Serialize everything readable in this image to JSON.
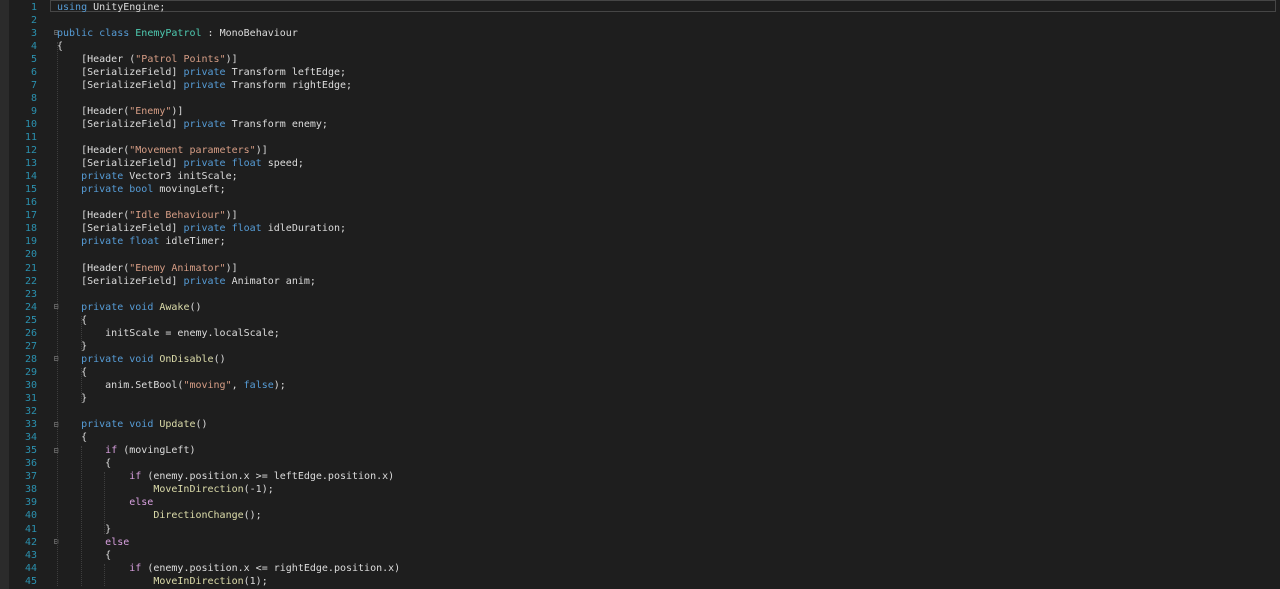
{
  "editor": {
    "language": "C#",
    "colors": {
      "background": "#1e1e1e",
      "line_number": "#2b91af",
      "keyword": "#569cd6",
      "type": "#4ec9b0",
      "string": "#d69d85",
      "method": "#dcdcaa",
      "control": "#d8a0df",
      "plain": "#dcdcdc"
    },
    "line_numbers": [
      "1",
      "2",
      "3",
      "4",
      "5",
      "6",
      "7",
      "8",
      "9",
      "10",
      "11",
      "12",
      "13",
      "14",
      "15",
      "16",
      "17",
      "18",
      "19",
      "20",
      "21",
      "22",
      "23",
      "24",
      "25",
      "26",
      "27",
      "28",
      "29",
      "30",
      "31",
      "32",
      "33",
      "34",
      "35",
      "36",
      "37",
      "38",
      "39",
      "40",
      "41",
      "42",
      "43",
      "44",
      "45"
    ],
    "fold_markers": [
      "3",
      "24",
      "28",
      "33",
      "35",
      "42"
    ],
    "lines": [
      {
        "n": 1,
        "t": [
          {
            "k": "kw",
            "v": "using"
          },
          {
            "k": "pl",
            "v": " UnityEngine;"
          }
        ]
      },
      {
        "n": 2,
        "t": []
      },
      {
        "n": 3,
        "t": [
          {
            "k": "kw",
            "v": "public class"
          },
          {
            "k": "pl",
            "v": " "
          },
          {
            "k": "ty",
            "v": "EnemyPatrol"
          },
          {
            "k": "pl",
            "v": " : "
          },
          {
            "k": "pl",
            "v": "MonoBehaviour"
          }
        ]
      },
      {
        "n": 4,
        "t": [
          {
            "k": "pl",
            "v": "{"
          }
        ]
      },
      {
        "n": 5,
        "t": [
          {
            "k": "pl",
            "v": "    [Header ("
          },
          {
            "k": "st",
            "v": "\"Patrol Points\""
          },
          {
            "k": "pl",
            "v": ")]"
          }
        ]
      },
      {
        "n": 6,
        "t": [
          {
            "k": "pl",
            "v": "    [SerializeField] "
          },
          {
            "k": "kw",
            "v": "private"
          },
          {
            "k": "pl",
            "v": " Transform leftEdge;"
          }
        ]
      },
      {
        "n": 7,
        "t": [
          {
            "k": "pl",
            "v": "    [SerializeField] "
          },
          {
            "k": "kw",
            "v": "private"
          },
          {
            "k": "pl",
            "v": " Transform rightEdge;"
          }
        ]
      },
      {
        "n": 8,
        "t": []
      },
      {
        "n": 9,
        "t": [
          {
            "k": "pl",
            "v": "    [Header("
          },
          {
            "k": "st",
            "v": "\"Enemy\""
          },
          {
            "k": "pl",
            "v": ")]"
          }
        ]
      },
      {
        "n": 10,
        "t": [
          {
            "k": "pl",
            "v": "    [SerializeField] "
          },
          {
            "k": "kw",
            "v": "private"
          },
          {
            "k": "pl",
            "v": " Transform enemy;"
          }
        ]
      },
      {
        "n": 11,
        "t": []
      },
      {
        "n": 12,
        "t": [
          {
            "k": "pl",
            "v": "    [Header("
          },
          {
            "k": "st",
            "v": "\"Movement parameters\""
          },
          {
            "k": "pl",
            "v": ")]"
          }
        ]
      },
      {
        "n": 13,
        "t": [
          {
            "k": "pl",
            "v": "    [SerializeField] "
          },
          {
            "k": "kw",
            "v": "private float"
          },
          {
            "k": "pl",
            "v": " speed;"
          }
        ]
      },
      {
        "n": 14,
        "t": [
          {
            "k": "pl",
            "v": "    "
          },
          {
            "k": "kw",
            "v": "private"
          },
          {
            "k": "pl",
            "v": " Vector3 initScale;"
          }
        ]
      },
      {
        "n": 15,
        "t": [
          {
            "k": "pl",
            "v": "    "
          },
          {
            "k": "kw",
            "v": "private bool"
          },
          {
            "k": "pl",
            "v": " movingLeft;"
          }
        ]
      },
      {
        "n": 16,
        "t": []
      },
      {
        "n": 17,
        "t": [
          {
            "k": "pl",
            "v": "    [Header("
          },
          {
            "k": "st",
            "v": "\"Idle Behaviour\""
          },
          {
            "k": "pl",
            "v": ")]"
          }
        ]
      },
      {
        "n": 18,
        "t": [
          {
            "k": "pl",
            "v": "    [SerializeField] "
          },
          {
            "k": "kw",
            "v": "private float"
          },
          {
            "k": "pl",
            "v": " idleDuration;"
          }
        ]
      },
      {
        "n": 19,
        "t": [
          {
            "k": "pl",
            "v": "    "
          },
          {
            "k": "kw",
            "v": "private float"
          },
          {
            "k": "pl",
            "v": " idleTimer;"
          }
        ]
      },
      {
        "n": 20,
        "t": []
      },
      {
        "n": 21,
        "t": [
          {
            "k": "pl",
            "v": "    [Header("
          },
          {
            "k": "st",
            "v": "\"Enemy Animator\""
          },
          {
            "k": "pl",
            "v": ")]"
          }
        ]
      },
      {
        "n": 22,
        "t": [
          {
            "k": "pl",
            "v": "    [SerializeField] "
          },
          {
            "k": "kw",
            "v": "private"
          },
          {
            "k": "pl",
            "v": " Animator anim;"
          }
        ]
      },
      {
        "n": 23,
        "t": []
      },
      {
        "n": 24,
        "t": [
          {
            "k": "pl",
            "v": "    "
          },
          {
            "k": "kw",
            "v": "private void"
          },
          {
            "k": "pl",
            "v": " "
          },
          {
            "k": "fn",
            "v": "Awake"
          },
          {
            "k": "pl",
            "v": "()"
          }
        ]
      },
      {
        "n": 25,
        "t": [
          {
            "k": "pl",
            "v": "    {"
          }
        ]
      },
      {
        "n": 26,
        "t": [
          {
            "k": "pl",
            "v": "        initScale = enemy.localScale;"
          }
        ]
      },
      {
        "n": 27,
        "t": [
          {
            "k": "pl",
            "v": "    }"
          }
        ]
      },
      {
        "n": 28,
        "t": [
          {
            "k": "pl",
            "v": "    "
          },
          {
            "k": "kw",
            "v": "private void"
          },
          {
            "k": "pl",
            "v": " "
          },
          {
            "k": "fn",
            "v": "OnDisable"
          },
          {
            "k": "pl",
            "v": "()"
          }
        ]
      },
      {
        "n": 29,
        "t": [
          {
            "k": "pl",
            "v": "    {"
          }
        ]
      },
      {
        "n": 30,
        "t": [
          {
            "k": "pl",
            "v": "        anim.SetBool("
          },
          {
            "k": "st",
            "v": "\"moving\""
          },
          {
            "k": "pl",
            "v": ", "
          },
          {
            "k": "kw",
            "v": "false"
          },
          {
            "k": "pl",
            "v": ");"
          }
        ]
      },
      {
        "n": 31,
        "t": [
          {
            "k": "pl",
            "v": "    }"
          }
        ]
      },
      {
        "n": 32,
        "t": []
      },
      {
        "n": 33,
        "t": [
          {
            "k": "pl",
            "v": "    "
          },
          {
            "k": "kw",
            "v": "private void"
          },
          {
            "k": "pl",
            "v": " "
          },
          {
            "k": "fn",
            "v": "Update"
          },
          {
            "k": "pl",
            "v": "()"
          }
        ]
      },
      {
        "n": 34,
        "t": [
          {
            "k": "pl",
            "v": "    {"
          }
        ]
      },
      {
        "n": 35,
        "t": [
          {
            "k": "pl",
            "v": "        "
          },
          {
            "k": "ctl",
            "v": "if"
          },
          {
            "k": "pl",
            "v": " (movingLeft)"
          }
        ]
      },
      {
        "n": 36,
        "t": [
          {
            "k": "pl",
            "v": "        {"
          }
        ]
      },
      {
        "n": 37,
        "t": [
          {
            "k": "pl",
            "v": "            "
          },
          {
            "k": "ctl",
            "v": "if"
          },
          {
            "k": "pl",
            "v": " (enemy.position.x >= leftEdge.position.x)"
          }
        ]
      },
      {
        "n": 38,
        "t": [
          {
            "k": "pl",
            "v": "                "
          },
          {
            "k": "fn",
            "v": "MoveInDirection"
          },
          {
            "k": "pl",
            "v": "(-1);"
          }
        ]
      },
      {
        "n": 39,
        "t": [
          {
            "k": "pl",
            "v": "            "
          },
          {
            "k": "ctl",
            "v": "else"
          }
        ]
      },
      {
        "n": 40,
        "t": [
          {
            "k": "pl",
            "v": "                "
          },
          {
            "k": "fn",
            "v": "DirectionChange"
          },
          {
            "k": "pl",
            "v": "();"
          }
        ]
      },
      {
        "n": 41,
        "t": [
          {
            "k": "pl",
            "v": "        }"
          }
        ]
      },
      {
        "n": 42,
        "t": [
          {
            "k": "pl",
            "v": "        "
          },
          {
            "k": "ctl",
            "v": "else"
          }
        ]
      },
      {
        "n": 43,
        "t": [
          {
            "k": "pl",
            "v": "        {"
          }
        ]
      },
      {
        "n": 44,
        "t": [
          {
            "k": "pl",
            "v": "            "
          },
          {
            "k": "ctl",
            "v": "if"
          },
          {
            "k": "pl",
            "v": " (enemy.position.x <= rightEdge.position.x)"
          }
        ]
      },
      {
        "n": 45,
        "t": [
          {
            "k": "pl",
            "v": "                "
          },
          {
            "k": "fn",
            "v": "MoveInDirection"
          },
          {
            "k": "pl",
            "v": "(1);"
          }
        ]
      }
    ]
  }
}
